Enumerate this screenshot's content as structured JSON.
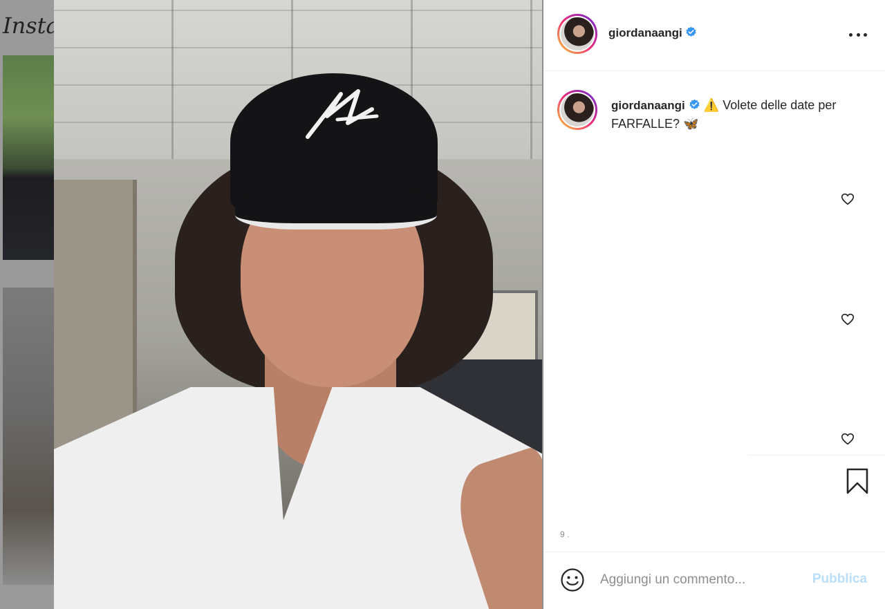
{
  "background": {
    "logo_text": "Insta"
  },
  "post": {
    "username": "giordanaangi",
    "verified": true,
    "caption_warning_icon": "⚠️",
    "caption_text": "Volete delle date per FARFALLE?",
    "caption_emoji": "🦋",
    "likes_count_text": "9 ."
  },
  "comment": {
    "placeholder": "Aggiungi un commento...",
    "publish_label": "Pubblica"
  },
  "colors": {
    "publish_disabled": "#b9dffc",
    "verified_blue": "#3897f0",
    "text_primary": "#262626"
  },
  "icons": {
    "more": "more-horizontal-icon",
    "like": "heart-outline-icon",
    "save": "bookmark-icon",
    "emoji": "smiley-icon",
    "mute": "speaker-muted-icon"
  }
}
